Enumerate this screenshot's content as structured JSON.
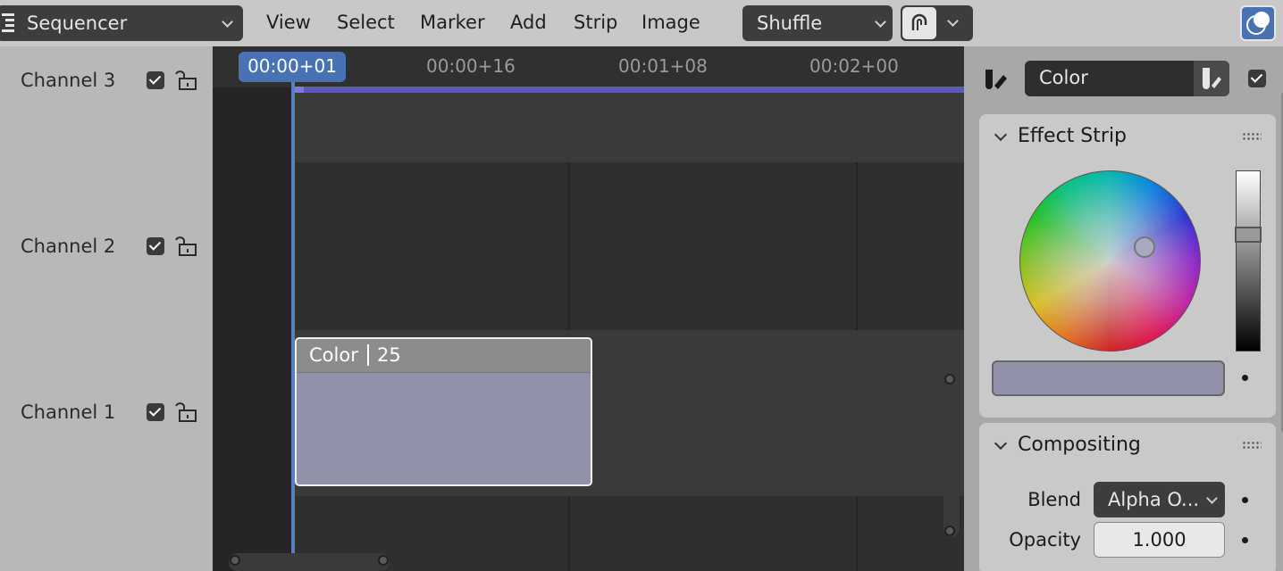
{
  "header": {
    "editor_type": "Sequencer",
    "menus": [
      "View",
      "Select",
      "Marker",
      "Add",
      "Strip",
      "Image"
    ],
    "overlap_mode": "Shuffle"
  },
  "channels": [
    {
      "label": "Channel 3"
    },
    {
      "label": "Channel 2"
    },
    {
      "label": "Channel 1"
    }
  ],
  "timeline": {
    "ruler_ticks": [
      "00:00+16",
      "00:01+08",
      "00:02+00"
    ],
    "current_frame": "00:00+01"
  },
  "strip": {
    "name": "Color",
    "length": "25",
    "color": "#9191a9"
  },
  "sidebar": {
    "strip_name": "Color",
    "effect_panel": {
      "title": "Effect Strip",
      "color": "#9191a9"
    },
    "compositing_panel": {
      "title": "Compositing",
      "blend_label": "Blend",
      "blend_value": "Alpha O...",
      "opacity_label": "Opacity",
      "opacity_value": "1.000"
    }
  },
  "colors": {
    "accent": "#4772b3",
    "range_bar": "#5a5ab8"
  }
}
